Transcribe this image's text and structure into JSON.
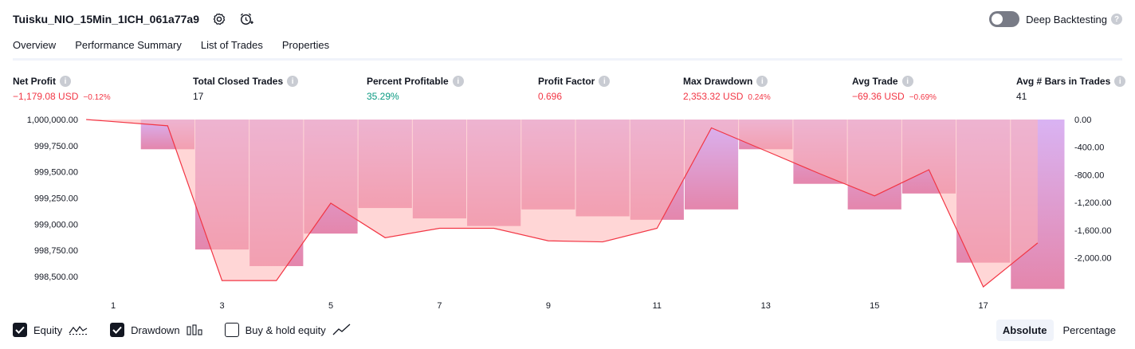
{
  "strategy": {
    "title": "Tuisku_NIO_15Min_1ICH_061a77a9",
    "settings_icon": "gear-icon",
    "alert_icon": "alarm-clock-plus-icon"
  },
  "deep_backtesting": {
    "label": "Deep Backtesting",
    "enabled": false
  },
  "tabs": [
    {
      "label": "Overview",
      "active": true
    },
    {
      "label": "Performance Summary",
      "active": false
    },
    {
      "label": "List of Trades",
      "active": false
    },
    {
      "label": "Properties",
      "active": false
    }
  ],
  "metrics": {
    "net_profit": {
      "label": "Net Profit",
      "value": "−1,179.08 USD",
      "pct": "−0.12%"
    },
    "total_closed_trades": {
      "label": "Total Closed Trades",
      "value": "17"
    },
    "percent_profitable": {
      "label": "Percent Profitable",
      "value": "35.29%"
    },
    "profit_factor": {
      "label": "Profit Factor",
      "value": "0.696"
    },
    "max_drawdown": {
      "label": "Max Drawdown",
      "value": "2,353.32 USD",
      "pct": "0.24%"
    },
    "avg_trade": {
      "label": "Avg Trade",
      "value": "−69.36 USD",
      "pct": "−0.69%"
    },
    "avg_bars": {
      "label": "Avg # Bars in Trades",
      "value": "41"
    }
  },
  "colors": {
    "equity_line": "#f23645",
    "drawdown_bar": "#d1a6f5",
    "drawdown_bar_bottom": "#e478a0",
    "equity_fill": "#ffb4b4",
    "negative": "#f23645",
    "positive": "#089981"
  },
  "chart_data": {
    "type": "line",
    "x": [
      1,
      2,
      3,
      4,
      5,
      6,
      7,
      8,
      9,
      10,
      11,
      12,
      13,
      14,
      15,
      16,
      17,
      18
    ],
    "x_tick_labels": [
      "1",
      "3",
      "5",
      "7",
      "9",
      "11",
      "13",
      "15",
      "17"
    ],
    "left_axis": {
      "ticks": [
        "1,000,000.00",
        "999,750.00",
        "999,500.00",
        "999,250.00",
        "999,000.00",
        "998,750.00",
        "998,500.00"
      ],
      "ylim": [
        998400,
        1000000
      ]
    },
    "right_axis": {
      "ticks": [
        "0.00",
        "-400.00",
        "-800.00",
        "-1,200.00",
        "-1,600.00",
        "-2,000.00"
      ],
      "ylim": [
        -2420,
        0
      ]
    },
    "series": [
      {
        "name": "Equity",
        "axis": "left",
        "values": [
          1000000,
          999940,
          998460,
          998460,
          999200,
          998870,
          998960,
          998960,
          998840,
          998830,
          998960,
          999920,
          999700,
          999480,
          999270,
          999520,
          998400,
          998820
        ]
      },
      {
        "name": "Drawdown",
        "axis": "right",
        "values": [
          0,
          -430,
          -1880,
          -2120,
          -1650,
          -1280,
          -1430,
          -1540,
          -1300,
          -1400,
          -1450,
          -1300,
          -430,
          -930,
          -1300,
          -1070,
          -2070,
          -2450
        ]
      }
    ],
    "legend": [
      "Equity",
      "Drawdown",
      "Buy & hold equity"
    ]
  },
  "legend": {
    "equity": {
      "label": "Equity",
      "checked": true,
      "icon": "equity-line-icon"
    },
    "drawdown": {
      "label": "Drawdown",
      "checked": true,
      "icon": "drawdown-bars-icon"
    },
    "buy_hold": {
      "label": "Buy & hold equity",
      "checked": false,
      "icon": "trend-line-icon"
    }
  },
  "view_mode": {
    "absolute": "Absolute",
    "percentage": "Percentage",
    "selected": "Absolute"
  }
}
